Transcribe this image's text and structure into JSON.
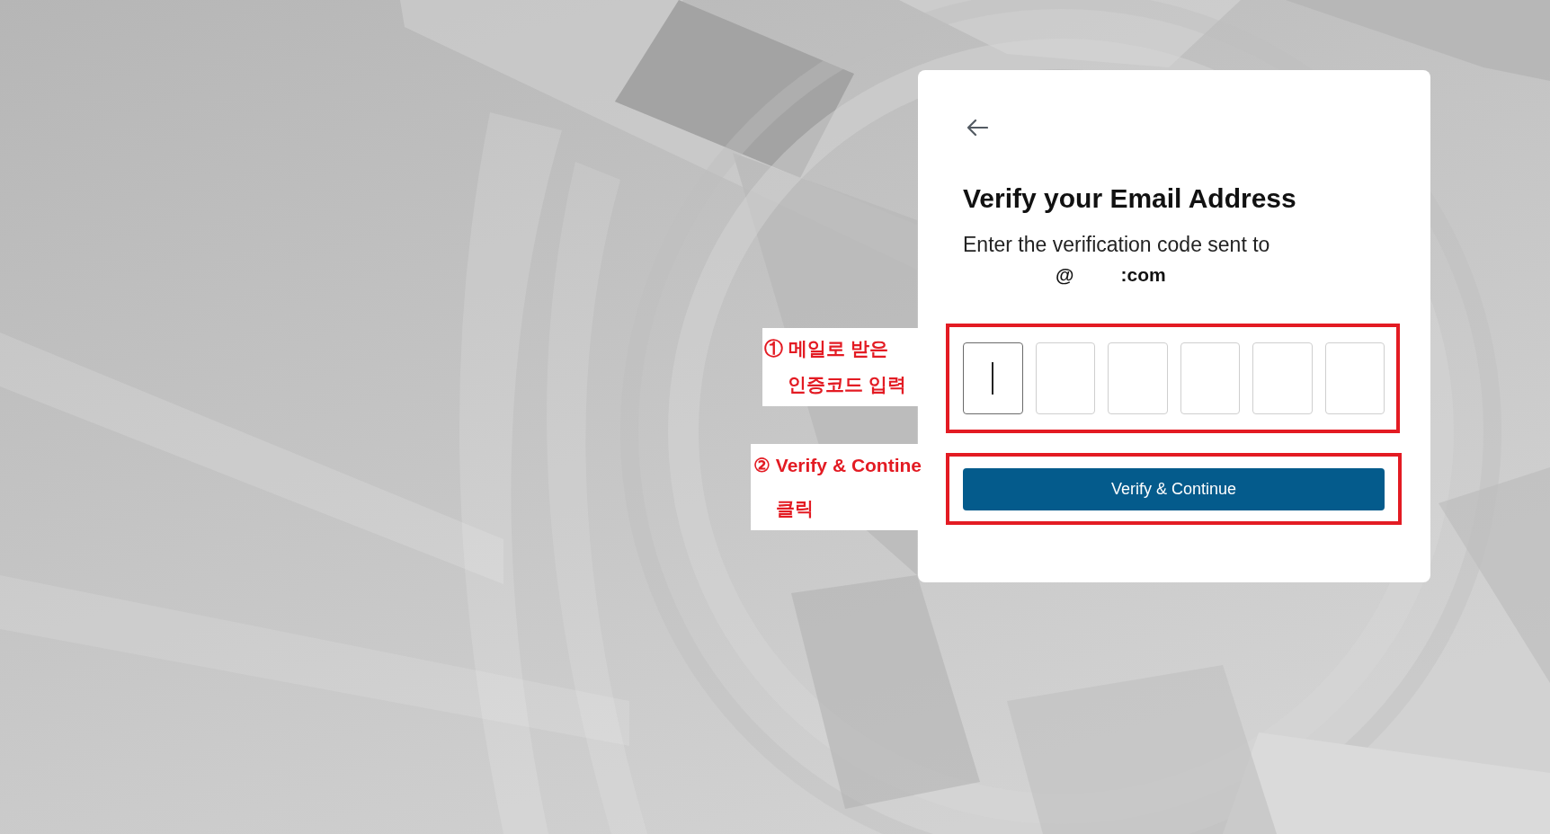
{
  "card": {
    "title": "Verify your Email Address",
    "subtitle": "Enter the verification code sent to",
    "email_parts": [
      "@",
      ":com"
    ],
    "code_inputs": [
      {
        "focused": true
      },
      {
        "focused": false
      },
      {
        "focused": false
      },
      {
        "focused": false
      },
      {
        "focused": false
      },
      {
        "focused": false
      }
    ],
    "button": "Verify & Continue"
  },
  "annotations": [
    {
      "lines": [
        "① 메일로 받은",
        "인증코드 입력"
      ]
    },
    {
      "lines": [
        "② Verify & Contine",
        "클릭"
      ]
    }
  ]
}
